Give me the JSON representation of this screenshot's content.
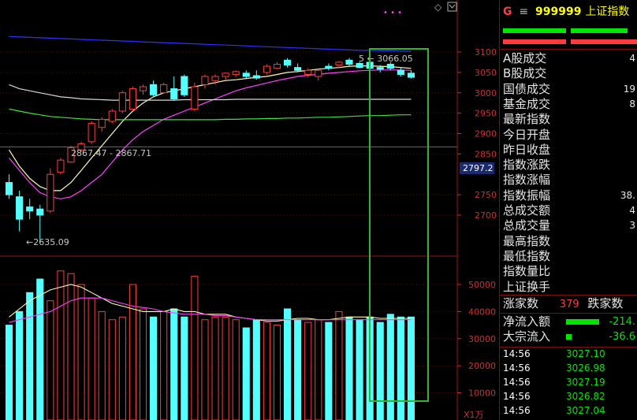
{
  "header": {
    "prefix": "G",
    "menu_icon": "≡",
    "code": "999999",
    "name": "上证指数"
  },
  "chart": {
    "type": "candlestick",
    "price_axis_ticks": [
      "3100",
      "3050",
      "3000",
      "2950",
      "2900",
      "2850",
      "2797.2",
      "2750",
      "2700"
    ],
    "current_price_label": "2797.2",
    "volume_axis_ticks": [
      "50000",
      "40000",
      "30000",
      "20000",
      "10000"
    ],
    "volume_unit": "X1万",
    "annotation_low": "2635.09",
    "annotation_range": "2867.47 - 2867.71",
    "annotation_high": "3066.05",
    "annotation_high_prefix": "5",
    "top_right_icon": "◇",
    "top_right_dots": "• • •",
    "colors": {
      "up": "#ff3c3c",
      "down": "#54ffff",
      "ma5": "#ffffb0",
      "ma10": "#ff40ff",
      "ma20": "#d8d8d8",
      "ma60": "#40e040",
      "ma120": "#3030ff",
      "highlight": "#2fb52f"
    }
  },
  "chart_data": {
    "type": "candlestick",
    "ylim": [
      2600,
      3130
    ],
    "candles": [
      {
        "o": 2780,
        "h": 2800,
        "l": 2740,
        "c": 2750
      },
      {
        "o": 2745,
        "h": 2760,
        "l": 2660,
        "c": 2690
      },
      {
        "o": 2720,
        "h": 2740,
        "l": 2690,
        "c": 2710
      },
      {
        "o": 2715,
        "h": 2725,
        "l": 2635.09,
        "c": 2700
      },
      {
        "o": 2710,
        "h": 2815,
        "l": 2705,
        "c": 2800
      },
      {
        "o": 2805,
        "h": 2840,
        "l": 2800,
        "c": 2835
      },
      {
        "o": 2830,
        "h": 2870,
        "l": 2828,
        "c": 2865
      },
      {
        "o": 2860,
        "h": 2880,
        "l": 2855,
        "c": 2875
      },
      {
        "o": 2880,
        "h": 2930,
        "l": 2875,
        "c": 2925
      },
      {
        "o": 2915,
        "h": 2940,
        "l": 2905,
        "c": 2935
      },
      {
        "o": 2930,
        "h": 2960,
        "l": 2925,
        "c": 2955
      },
      {
        "o": 2955,
        "h": 3005,
        "l": 2950,
        "c": 3000
      },
      {
        "o": 2960,
        "h": 3015,
        "l": 2955,
        "c": 3010
      },
      {
        "o": 3005,
        "h": 3020,
        "l": 2995,
        "c": 3015
      },
      {
        "o": 3020,
        "h": 3030,
        "l": 2990,
        "c": 2995
      },
      {
        "o": 3000,
        "h": 3025,
        "l": 2998,
        "c": 3020
      },
      {
        "o": 3010,
        "h": 3040,
        "l": 2980,
        "c": 2985
      },
      {
        "o": 3040,
        "h": 3045,
        "l": 2990,
        "c": 2995
      },
      {
        "o": 2960,
        "h": 3025,
        "l": 2955,
        "c": 3015
      },
      {
        "o": 3020,
        "h": 3045,
        "l": 3010,
        "c": 3040
      },
      {
        "o": 3030,
        "h": 3045,
        "l": 3020,
        "c": 3040
      },
      {
        "o": 3040,
        "h": 3050,
        "l": 3032,
        "c": 3048
      },
      {
        "o": 3045,
        "h": 3055,
        "l": 3038,
        "c": 3052
      },
      {
        "o": 3048,
        "h": 3055,
        "l": 3035,
        "c": 3040
      },
      {
        "o": 3042,
        "h": 3055,
        "l": 3032,
        "c": 3036
      },
      {
        "o": 3050,
        "h": 3070,
        "l": 3045,
        "c": 3065
      },
      {
        "o": 3060,
        "h": 3075,
        "l": 3058,
        "c": 3070
      },
      {
        "o": 3080,
        "h": 3085,
        "l": 3062,
        "c": 3068
      },
      {
        "o": 3062,
        "h": 3072,
        "l": 3050,
        "c": 3055
      },
      {
        "o": 3045,
        "h": 3060,
        "l": 3038,
        "c": 3055
      },
      {
        "o": 3040,
        "h": 3058,
        "l": 3030,
        "c": 3055
      },
      {
        "o": 3065,
        "h": 3072,
        "l": 3055,
        "c": 3060
      },
      {
        "o": 3068,
        "h": 3078,
        "l": 3060,
        "c": 3075
      },
      {
        "o": 3080,
        "h": 3085,
        "l": 3065,
        "c": 3070
      },
      {
        "o": 3072,
        "h": 3076,
        "l": 3060,
        "c": 3062
      },
      {
        "o": 3075,
        "h": 3080,
        "l": 3050,
        "c": 3060
      },
      {
        "o": 3062,
        "h": 3068,
        "l": 3050,
        "c": 3058
      },
      {
        "o": 3070,
        "h": 3075,
        "l": 3055,
        "c": 3060
      },
      {
        "o": 3055,
        "h": 3062,
        "l": 3040,
        "c": 3045
      },
      {
        "o": 3048,
        "h": 3055,
        "l": 3035,
        "c": 3038
      }
    ],
    "volume": [
      35000,
      40000,
      47000,
      52000,
      44000,
      55000,
      54000,
      50000,
      45000,
      40000,
      37000,
      38000,
      50000,
      41000,
      38000,
      40000,
      41000,
      38000,
      53000,
      37000,
      38000,
      38000,
      37000,
      34000,
      37000,
      36000,
      35000,
      41000,
      37000,
      36000,
      37000,
      36000,
      40000,
      38000,
      37000,
      38000,
      36000,
      39000,
      38000,
      38000
    ],
    "volume_ylim": [
      0,
      60000
    ],
    "ma_lines": [
      {
        "name": "MA5",
        "values": [
          2860,
          2820,
          2790,
          2770,
          2760,
          2760,
          2780,
          2810,
          2840,
          2870,
          2900,
          2930,
          2955,
          2975,
          2990,
          3000,
          3005,
          3010,
          3015,
          3020,
          3025,
          3030,
          3032,
          3035,
          3038,
          3040,
          3045,
          3050,
          3052,
          3055,
          3058,
          3060,
          3062,
          3065,
          3066,
          3066,
          3065,
          3064,
          3062,
          3060
        ]
      },
      {
        "name": "MA10",
        "values": [
          2840,
          2810,
          2780,
          2755,
          2745,
          2740,
          2745,
          2760,
          2780,
          2800,
          2830,
          2860,
          2885,
          2905,
          2920,
          2935,
          2945,
          2955,
          2965,
          2975,
          2985,
          2995,
          3005,
          3012,
          3018,
          3024,
          3030,
          3035,
          3040,
          3043,
          3045,
          3048,
          3050,
          3052,
          3054,
          3055,
          3056,
          3056,
          3056,
          3055
        ]
      },
      {
        "name": "MA20",
        "values": [
          3020,
          3010,
          3005,
          3000,
          2995,
          2990,
          2988,
          2985,
          2984,
          2983,
          2982,
          2982,
          2982,
          2982,
          2982,
          2982,
          2982,
          2983,
          2983,
          2983,
          2983,
          2983,
          2984,
          2984,
          2984,
          2984,
          2984,
          2984,
          2984,
          2984,
          2984,
          2984,
          2984,
          2984,
          2984,
          2984,
          2984,
          2984,
          2984,
          2984
        ]
      },
      {
        "name": "MA60",
        "values": [
          2960,
          2955,
          2950,
          2946,
          2942,
          2940,
          2938,
          2936,
          2935,
          2934,
          2934,
          2934,
          2934,
          2934,
          2934,
          2934,
          2934,
          2934,
          2934,
          2934,
          2934,
          2935,
          2935,
          2936,
          2936,
          2937,
          2937,
          2938,
          2938,
          2939,
          2940,
          2940,
          2941,
          2942,
          2943,
          2944,
          2944,
          2945,
          2946,
          2946
        ]
      },
      {
        "name": "MA120",
        "values": [
          3138,
          3137,
          3136,
          3135,
          3134,
          3133,
          3132,
          3131,
          3130,
          3129,
          3128,
          3127,
          3126,
          3125,
          3124,
          3123,
          3122,
          3121,
          3120,
          3119,
          3118,
          3117,
          3116,
          3115,
          3114,
          3113,
          3112,
          3111,
          3110,
          3109,
          3108,
          3107,
          3106,
          3105,
          3104,
          3104,
          3103,
          3103,
          3102,
          3102
        ]
      }
    ],
    "volume_ma": [
      {
        "name": "VMA5",
        "values": [
          38000,
          41000,
          44000,
          46000,
          48000,
          49000,
          50000,
          49000,
          47000,
          45000,
          43000,
          42000,
          41000,
          40000,
          40000,
          40000,
          41000,
          40000,
          40000,
          39000,
          39000,
          39000,
          38000,
          37500,
          37000,
          36500,
          36500,
          37000,
          37500,
          37500,
          37000,
          37000,
          37500,
          38000,
          38000,
          38000,
          37500,
          37500,
          37500,
          37500
        ]
      },
      {
        "name": "VMA10",
        "values": [
          36000,
          37000,
          38000,
          39000,
          40000,
          42000,
          44000,
          45000,
          45000,
          45000,
          44000,
          43000,
          42000,
          41500,
          41000,
          40000,
          39500,
          39000,
          39000,
          39000,
          38500,
          38500,
          38000,
          37500,
          37000,
          37000,
          37000,
          37000,
          37000,
          37000,
          37000,
          37000,
          37000,
          37000,
          37000,
          37000,
          37000,
          37000,
          37000,
          37000
        ]
      }
    ]
  },
  "panel": {
    "labels": [
      {
        "label": "A股成交",
        "value": "4"
      },
      {
        "label": "B股成交",
        "value": ""
      },
      {
        "label": "国债成交",
        "value": "19"
      },
      {
        "label": "基金成交",
        "value": "8"
      },
      {
        "label": "最新指数",
        "value": ""
      },
      {
        "label": "今日开盘",
        "value": ""
      },
      {
        "label": "昨日收盘",
        "value": ""
      },
      {
        "label": "指数涨跌",
        "value": ""
      },
      {
        "label": "指数涨幅",
        "value": ""
      },
      {
        "label": "指数振幅",
        "value": "38."
      },
      {
        "label": "总成交额",
        "value": "4"
      },
      {
        "label": "总成交量",
        "value": "3"
      },
      {
        "label": "最高指数",
        "value": ""
      },
      {
        "label": "最低指数",
        "value": ""
      },
      {
        "label": "指数量比",
        "value": ""
      },
      {
        "label": "上证换手",
        "value": ""
      }
    ],
    "breadth": {
      "up_label": "涨家数",
      "up_value": "379",
      "down_label": "跌家数"
    },
    "flows": [
      {
        "label": "净流入额",
        "value": "-214."
      },
      {
        "label": "大宗流入",
        "value": "-36.6"
      }
    ],
    "ticks": [
      {
        "time": "14:56",
        "value": "3027.10"
      },
      {
        "time": "14:56",
        "value": "3026.98"
      },
      {
        "time": "14:56",
        "value": "3027.19"
      },
      {
        "time": "14:56",
        "value": "3026.82"
      },
      {
        "time": "14:56",
        "value": "3027.04"
      }
    ]
  }
}
